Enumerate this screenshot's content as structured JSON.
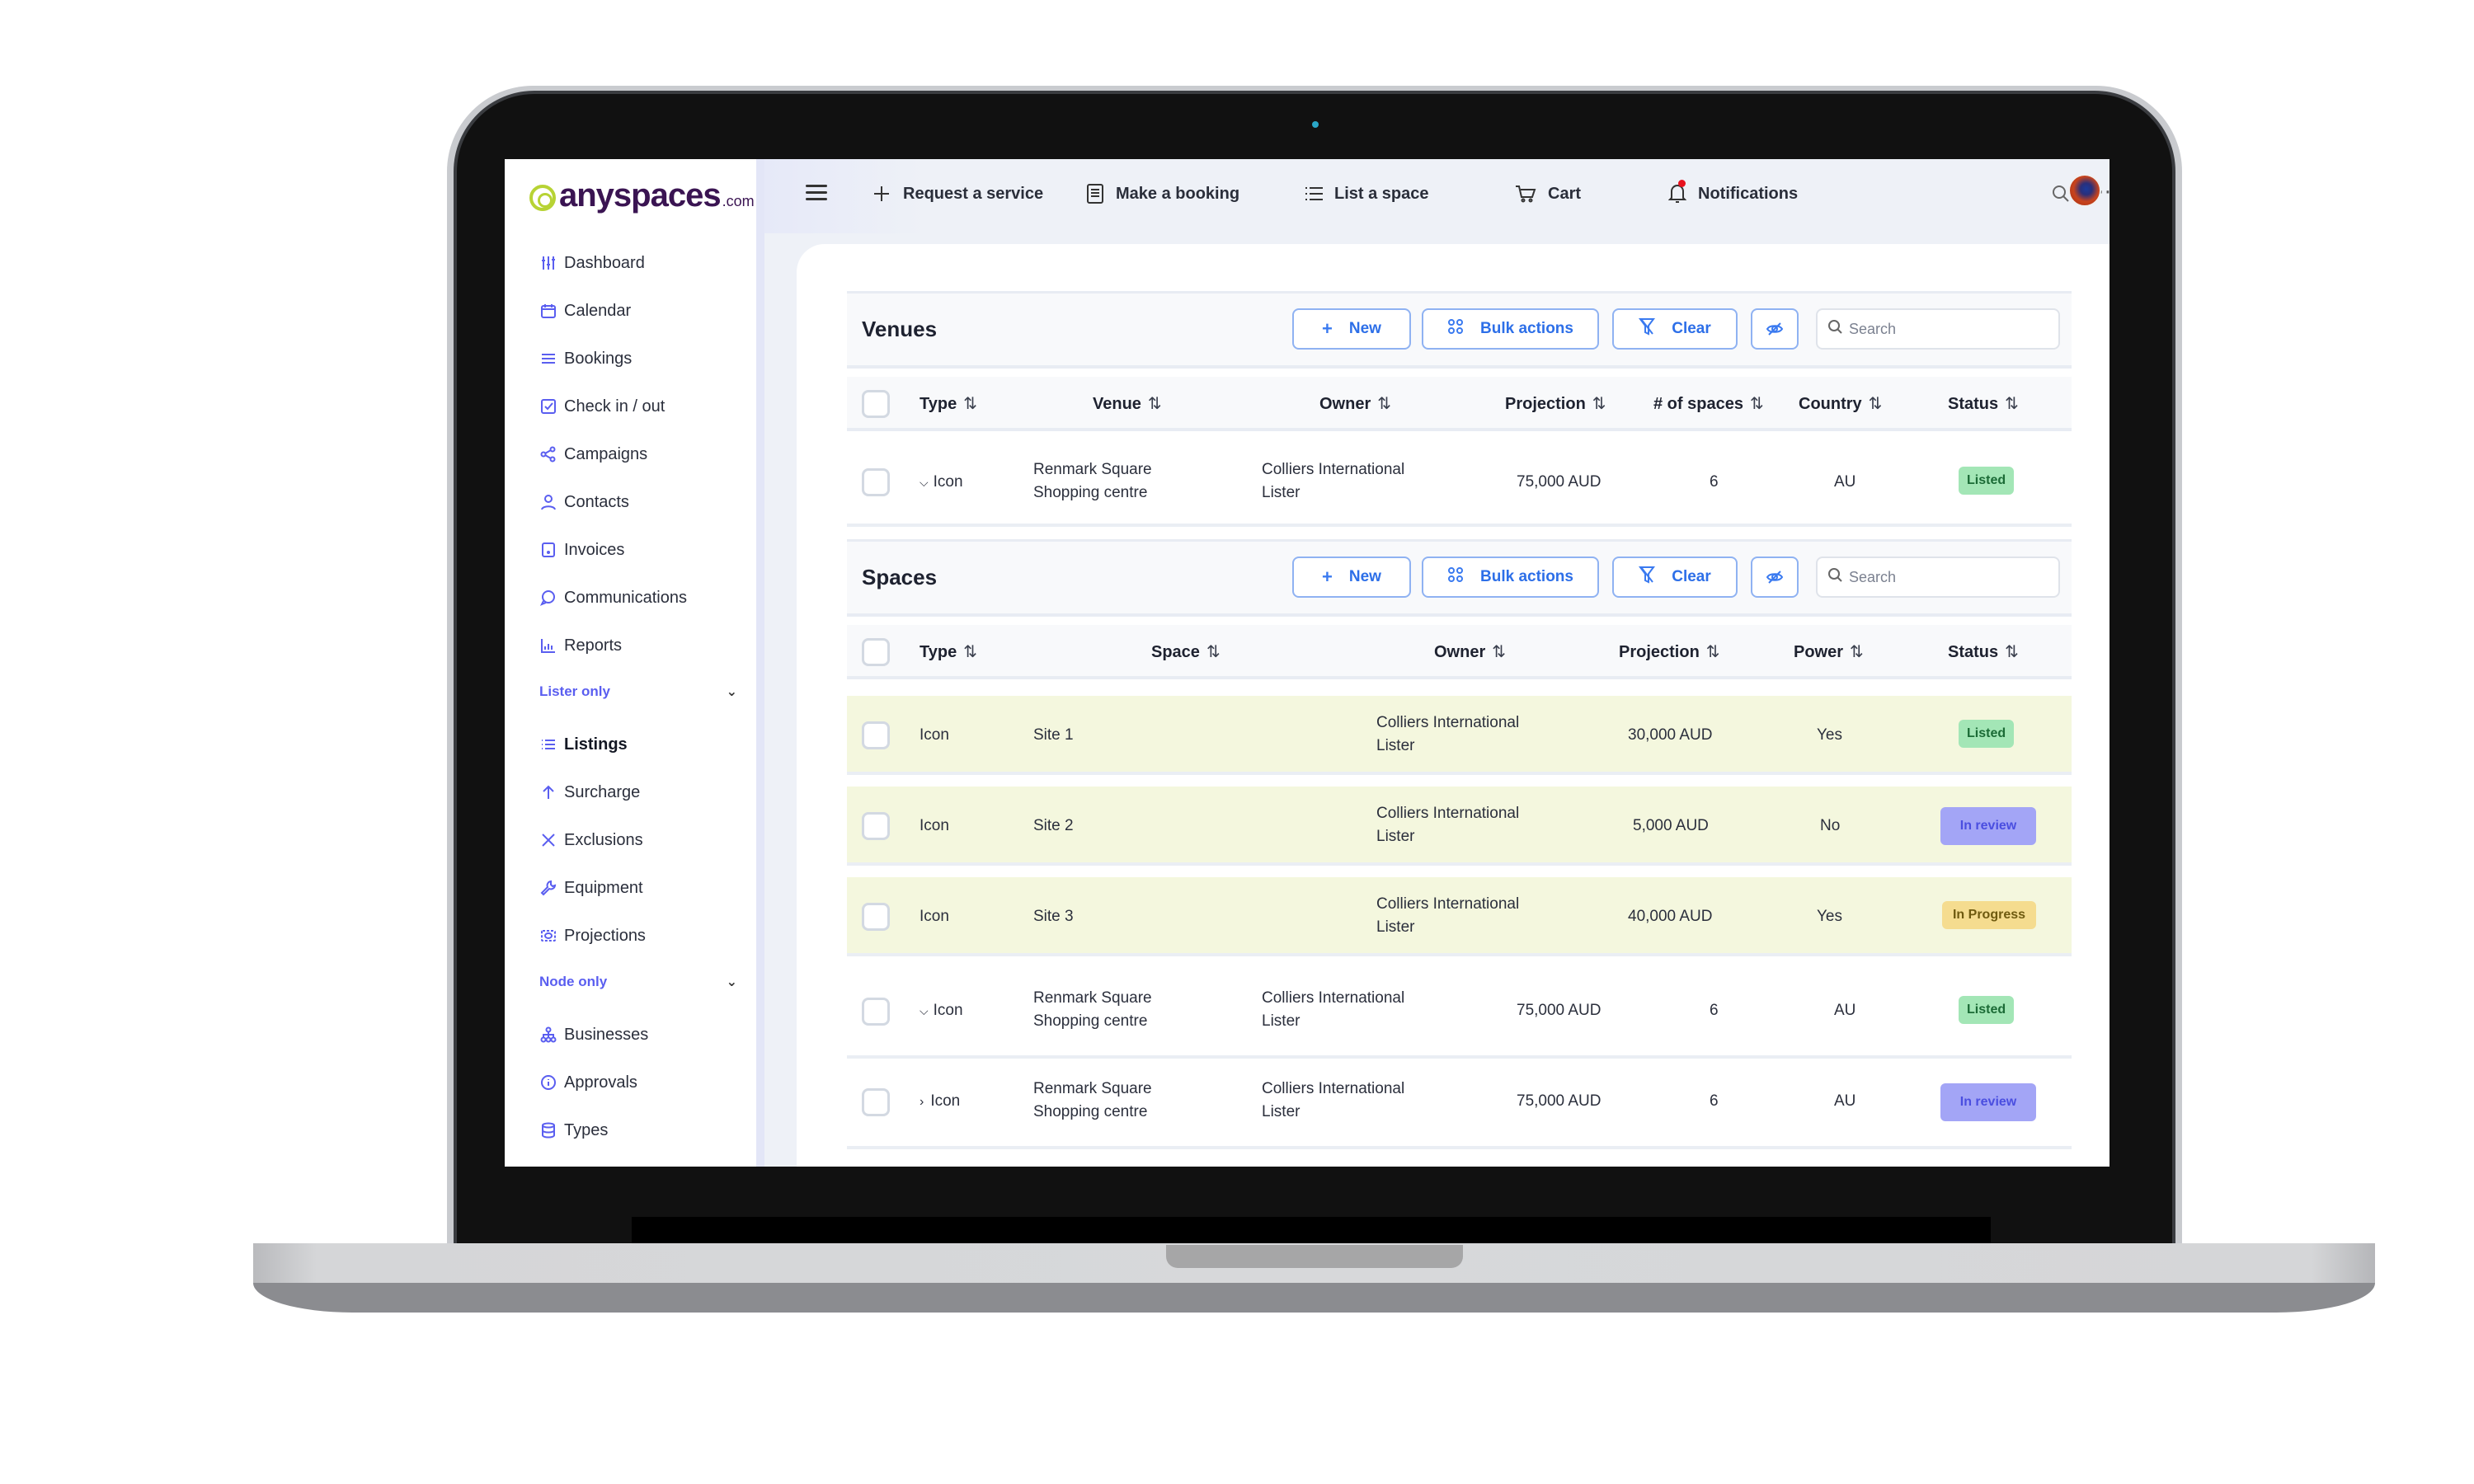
{
  "brand": {
    "name": "anyspaces",
    "suffix": ".com"
  },
  "sidebar": {
    "items": [
      {
        "label": "Dashboard",
        "icon": "sliders-icon"
      },
      {
        "label": "Calendar",
        "icon": "calendar-icon"
      },
      {
        "label": "Bookings",
        "icon": "menu-lines-icon"
      },
      {
        "label": "Check in / out",
        "icon": "check-square-icon"
      },
      {
        "label": "Campaigns",
        "icon": "share-icon"
      },
      {
        "label": "Contacts",
        "icon": "user-icon"
      },
      {
        "label": "Invoices",
        "icon": "invoice-icon"
      },
      {
        "label": "Communications",
        "icon": "chat-icon"
      },
      {
        "label": "Reports",
        "icon": "bar-chart-icon"
      }
    ],
    "sections": [
      {
        "title": "Lister only",
        "items": [
          {
            "label": "Listings",
            "icon": "list-icon",
            "active": true
          },
          {
            "label": "Surcharge",
            "icon": "arrow-up-icon"
          },
          {
            "label": "Exclusions",
            "icon": "x-icon"
          },
          {
            "label": "Equipment",
            "icon": "wrench-icon"
          },
          {
            "label": "Projections",
            "icon": "projector-icon"
          }
        ]
      },
      {
        "title": "Node only",
        "items": [
          {
            "label": "Businesses",
            "icon": "org-chart-icon"
          },
          {
            "label": "Approvals",
            "icon": "info-circle-icon"
          },
          {
            "label": "Types",
            "icon": "database-icon"
          }
        ]
      }
    ]
  },
  "topbar": {
    "items": [
      {
        "label": "Request a service",
        "icon": "plus-icon"
      },
      {
        "label": "Make a booking",
        "icon": "booking-icon"
      },
      {
        "label": "List a space",
        "icon": "list-icon"
      },
      {
        "label": "Cart",
        "icon": "cart-icon"
      },
      {
        "label": "Notifications",
        "icon": "bell-icon",
        "has_unread": true
      }
    ]
  },
  "venues": {
    "title": "Venues",
    "buttons": {
      "new": "New",
      "bulk": "Bulk actions",
      "clear": "Clear"
    },
    "search_placeholder": "Search",
    "columns": [
      "Type",
      "Venue",
      "Owner",
      "Projection",
      "# of spaces",
      "Country",
      "Status"
    ],
    "rows": [
      {
        "expander": "v",
        "type": "Icon",
        "venue_line1": "Renmark Square",
        "venue_line2": "Shopping centre",
        "owner_line1": "Colliers International",
        "owner_line2": "Lister",
        "projection": "75,000 AUD",
        "spaces": "6",
        "country": "AU",
        "status": "Listed"
      }
    ]
  },
  "spaces": {
    "title": "Spaces",
    "buttons": {
      "new": "New",
      "bulk": "Bulk actions",
      "clear": "Clear"
    },
    "search_placeholder": "Search",
    "columns": [
      "Type",
      "Space",
      "Owner",
      "Projection",
      "Power",
      "Status"
    ],
    "site_rows": [
      {
        "type": "Icon",
        "space": "Site 1",
        "owner_line1": "Colliers International",
        "owner_line2": "Lister",
        "projection": "30,000 AUD",
        "power": "Yes",
        "status": "Listed"
      },
      {
        "type": "Icon",
        "space": "Site 2",
        "owner_line1": "Colliers International",
        "owner_line2": "Lister",
        "projection": "5,000 AUD",
        "power": "No",
        "status": "In review"
      },
      {
        "type": "Icon",
        "space": "Site 3",
        "owner_line1": "Colliers International",
        "owner_line2": "Lister",
        "projection": "40,000 AUD",
        "power": "Yes",
        "status": "In Progress"
      }
    ],
    "venue_rows": [
      {
        "expander": "v",
        "type": "Icon",
        "venue_line1": "Renmark Square",
        "venue_line2": "Shopping centre",
        "owner_line1": "Colliers International",
        "owner_line2": "Lister",
        "projection": "75,000 AUD",
        "spaces": "6",
        "country": "AU",
        "status": "Listed"
      },
      {
        "expander": ">",
        "type": "Icon",
        "venue_line1": "Renmark Square",
        "venue_line2": "Shopping centre",
        "owner_line1": "Colliers International",
        "owner_line2": "Lister",
        "projection": "75,000 AUD",
        "spaces": "6",
        "country": "AU",
        "status": "In review"
      }
    ]
  },
  "colors": {
    "accent": "#5a5ef0",
    "button_blue": "#2d6fe8",
    "brand_purple": "#3a1452",
    "brand_green": "#b7d334",
    "highlight_row": "#f4f7de",
    "status_listed": "#a3e6b6",
    "status_review": "#a3a5f6",
    "status_progress": "#f5dc8f"
  }
}
